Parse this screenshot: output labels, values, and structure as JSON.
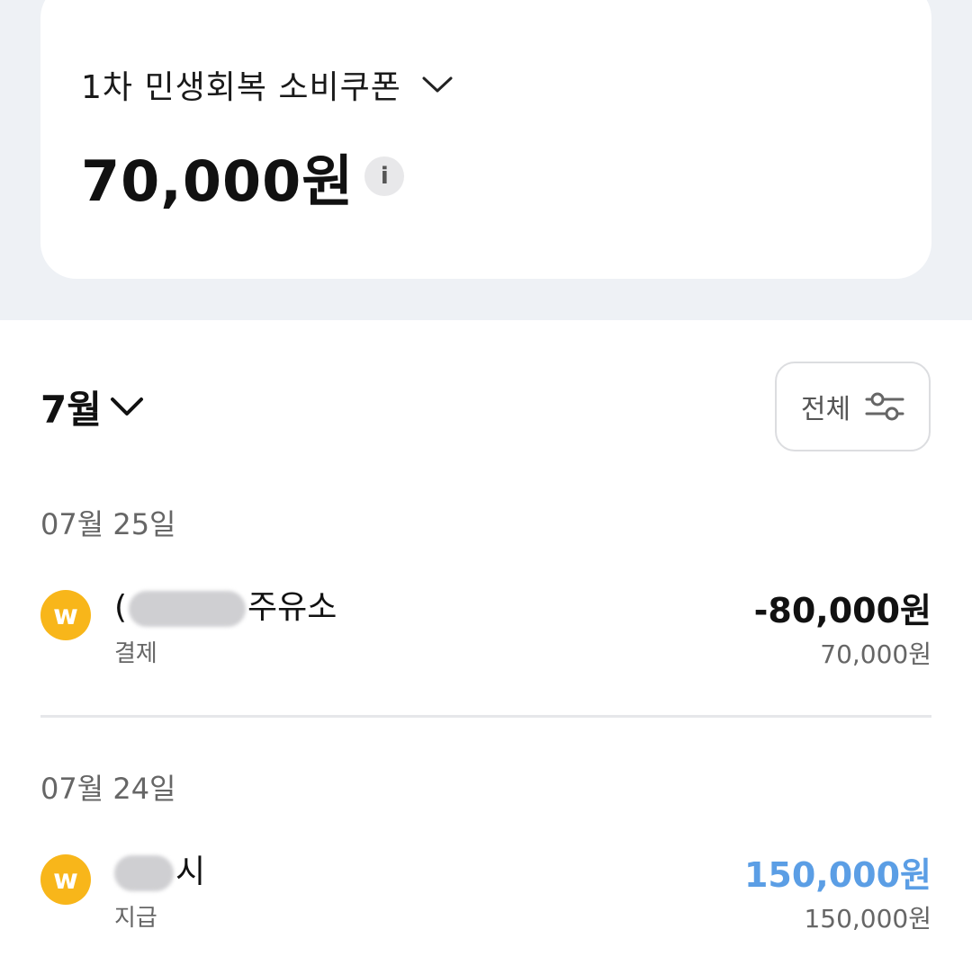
{
  "coupon": {
    "title": "1차 민생회복 소비쿠폰",
    "balance": "70,000원",
    "info_icon": "i"
  },
  "history": {
    "month": "7월",
    "filter_label": "전체"
  },
  "groups": [
    {
      "date": "07월 25일",
      "transactions": [
        {
          "name_prefix": "(",
          "name_suffix": "주유소",
          "type": "결제",
          "amount": "-80,000원",
          "balance": "70,000원",
          "icon": "won-coin-icon",
          "won_symbol": "w"
        }
      ]
    },
    {
      "date": "07월 24일",
      "transactions": [
        {
          "name_prefix": "",
          "name_suffix": "시",
          "type": "지급",
          "amount": "150,000원",
          "balance": "150,000원",
          "icon": "won-coin-icon",
          "won_symbol": "w"
        }
      ]
    }
  ],
  "colors": {
    "background_top": "#eef1f5",
    "coin": "#f8b61a",
    "positive_amount": "#5b9ee5"
  }
}
